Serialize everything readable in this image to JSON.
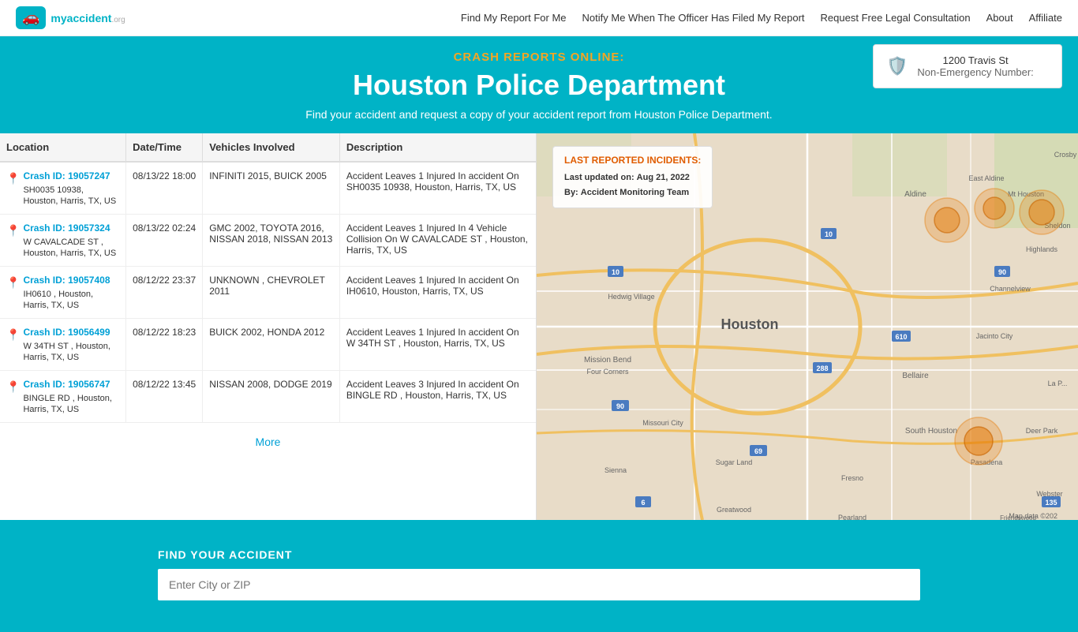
{
  "header": {
    "logo_text": "myaccident",
    "logo_sub": ".org",
    "nav_links": [
      {
        "label": "Find My Report For Me",
        "href": "#"
      },
      {
        "label": "Notify Me When The Officer Has Filed My Report",
        "href": "#"
      },
      {
        "label": "Request Free Legal Consultation",
        "href": "#"
      },
      {
        "label": "About",
        "href": "#"
      },
      {
        "label": "Affiliate",
        "href": "#"
      }
    ]
  },
  "hero": {
    "subtitle": "CRASH REPORTS ONLINE:",
    "title": "Houston Police Department",
    "description": "Find your accident and request a copy of your accident report from Houston Police Department."
  },
  "address_card": {
    "address": "1200 Travis St",
    "non_emergency": "Non-Emergency Number:"
  },
  "table": {
    "columns": [
      "Location",
      "Date/Time",
      "Vehicles Involved",
      "Description"
    ],
    "rows": [
      {
        "crash_id": "Crash ID: 19057247",
        "location": "SH0035 10938, Houston, Harris, TX, US",
        "datetime": "08/13/22 18:00",
        "vehicles": "INFINITI 2015, BUICK 2005",
        "description": "Accident Leaves 1 Injured In accident On SH0035 10938, Houston, Harris, TX, US"
      },
      {
        "crash_id": "Crash ID: 19057324",
        "location": "W CAVALCADE ST , Houston, Harris, TX, US",
        "datetime": "08/13/22 02:24",
        "vehicles": "GMC 2002, TOYOTA 2016, NISSAN 2018, NISSAN 2013",
        "description": "Accident Leaves 1 Injured In 4 Vehicle Collision On W CAVALCADE ST , Houston, Harris, TX, US"
      },
      {
        "crash_id": "Crash ID: 19057408",
        "location": "IH0610 , Houston, Harris, TX, US",
        "datetime": "08/12/22 23:37",
        "vehicles": "UNKNOWN , CHEVROLET 2011",
        "description": "Accident Leaves 1 Injured In accident On IH0610, Houston, Harris, TX, US"
      },
      {
        "crash_id": "Crash ID: 19056499",
        "location": "W 34TH ST , Houston, Harris, TX, US",
        "datetime": "08/12/22 18:23",
        "vehicles": "BUICK 2002, HONDA 2012",
        "description": "Accident Leaves 1 Injured In accident On W 34TH ST , Houston, Harris, TX, US"
      },
      {
        "crash_id": "Crash ID: 19056747",
        "location": "BINGLE RD , Houston, Harris, TX, US",
        "datetime": "08/12/22 13:45",
        "vehicles": "NISSAN 2008, DODGE 2019",
        "description": "Accident Leaves 3 Injured In accident On BINGLE RD , Houston, Harris, TX, US"
      }
    ],
    "more_label": "More"
  },
  "incidents_card": {
    "title": "LAST REPORTED INCIDENTS:",
    "last_updated_label": "Last updated on:",
    "last_updated_value": "Aug 21, 2022",
    "by_label": "By:",
    "by_value": "Accident Monitoring Team"
  },
  "find_accident": {
    "title": "FIND YOUR ACCIDENT",
    "placeholder": "Enter City or ZIP"
  },
  "colors": {
    "accent": "#00b3c6",
    "orange": "#f5a623",
    "link": "#00a0d6"
  }
}
